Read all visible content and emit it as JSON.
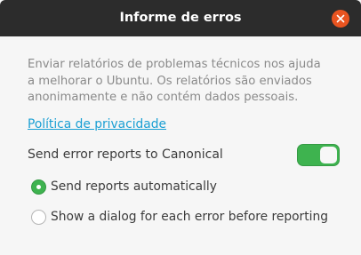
{
  "window": {
    "title": "Informe de erros"
  },
  "icons": {
    "close": "close-icon"
  },
  "colors": {
    "titlebar": "#2c2c2c",
    "close_button": "#e95420",
    "accent_green": "#3eb34f",
    "link": "#1a9fd3"
  },
  "description": {
    "line1": "Enviar relatórios de problemas técnicos nos ajuda",
    "line2": "a melhorar o Ubuntu. Os relatórios são enviados",
    "line3": "anonimamente e não contém dados pessoais."
  },
  "privacy_link": "Política de privacidade",
  "send_reports": {
    "label": "Send error reports to Canonical",
    "enabled": true
  },
  "options": [
    {
      "label": "Send reports automatically",
      "selected": true
    },
    {
      "label": "Show a dialog for each error before reporting",
      "selected": false
    }
  ]
}
